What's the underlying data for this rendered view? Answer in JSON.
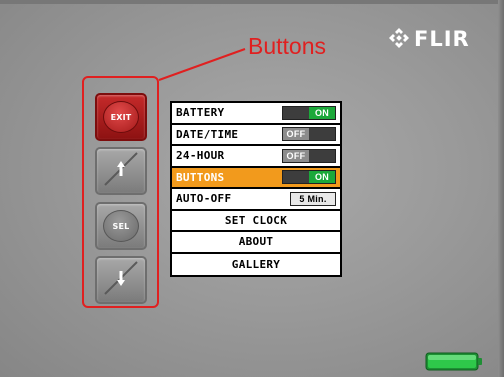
{
  "logo": {
    "text": "FLIR",
    "icon": "flir-logo-icon"
  },
  "annotation": {
    "label": "Buttons",
    "color": "#e02020"
  },
  "buttons": {
    "exit": {
      "label": "EXIT",
      "color": "#b31f1f"
    },
    "up": {
      "icon": "arrow-up-icon"
    },
    "select": {
      "label": "SEL"
    },
    "down": {
      "icon": "arrow-down-icon"
    }
  },
  "menu": {
    "items": [
      {
        "label": "BATTERY",
        "control": "toggle",
        "state": "ON"
      },
      {
        "label": "DATE/TIME",
        "control": "toggle",
        "state": "OFF"
      },
      {
        "label": "24-HOUR",
        "control": "toggle",
        "state": "OFF"
      },
      {
        "label": "BUTTONS",
        "control": "toggle",
        "state": "ON",
        "selected": true
      },
      {
        "label": "AUTO-OFF",
        "control": "value",
        "value": "5 Min."
      },
      {
        "label": "SET CLOCK"
      },
      {
        "label": "ABOUT"
      },
      {
        "label": "GALLERY"
      }
    ],
    "highlight_color": "#f29a1c",
    "on_color": "#1ca83a"
  },
  "status": {
    "battery_icon": "battery-full-icon",
    "battery_level": 1.0,
    "battery_color": "#2ec84a"
  }
}
